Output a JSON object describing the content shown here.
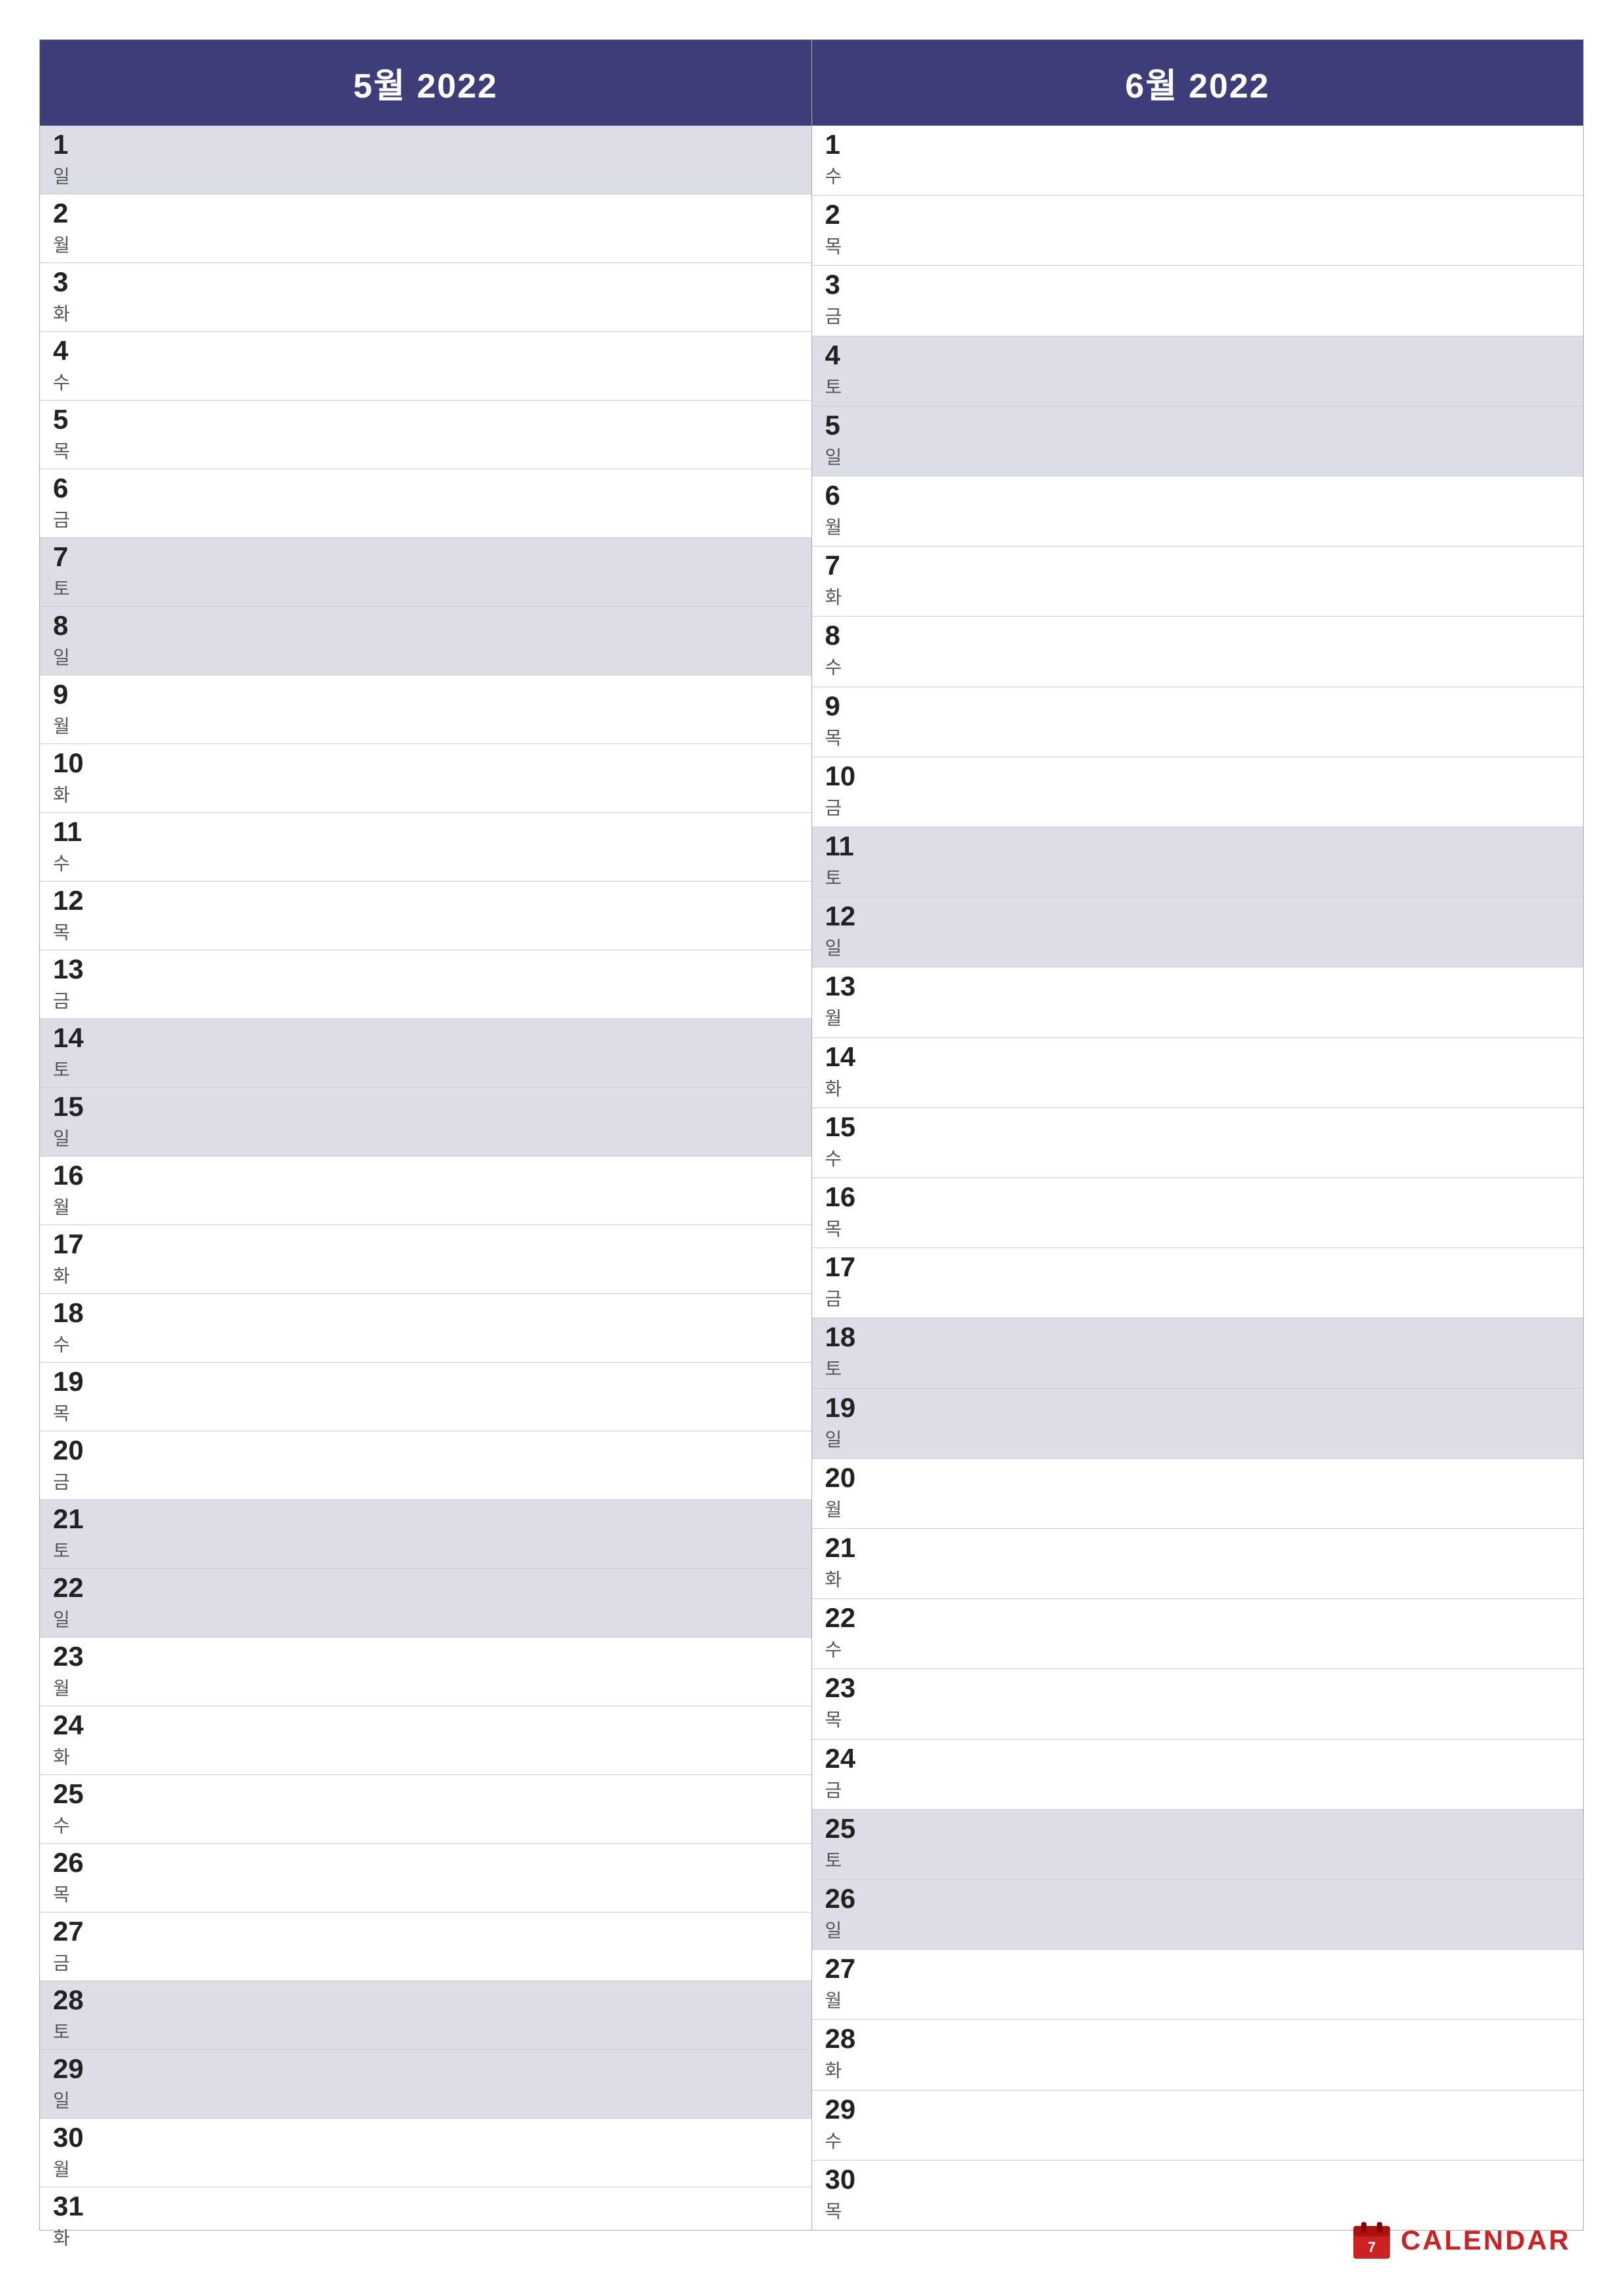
{
  "months": [
    {
      "title": "5월 2022",
      "days": [
        {
          "num": "1",
          "name": "일",
          "weekend": true
        },
        {
          "num": "2",
          "name": "월",
          "weekend": false
        },
        {
          "num": "3",
          "name": "화",
          "weekend": false
        },
        {
          "num": "4",
          "name": "수",
          "weekend": false
        },
        {
          "num": "5",
          "name": "목",
          "weekend": false
        },
        {
          "num": "6",
          "name": "금",
          "weekend": false
        },
        {
          "num": "7",
          "name": "토",
          "weekend": true
        },
        {
          "num": "8",
          "name": "일",
          "weekend": true
        },
        {
          "num": "9",
          "name": "월",
          "weekend": false
        },
        {
          "num": "10",
          "name": "화",
          "weekend": false
        },
        {
          "num": "11",
          "name": "수",
          "weekend": false
        },
        {
          "num": "12",
          "name": "목",
          "weekend": false
        },
        {
          "num": "13",
          "name": "금",
          "weekend": false
        },
        {
          "num": "14",
          "name": "토",
          "weekend": true
        },
        {
          "num": "15",
          "name": "일",
          "weekend": true
        },
        {
          "num": "16",
          "name": "월",
          "weekend": false
        },
        {
          "num": "17",
          "name": "화",
          "weekend": false
        },
        {
          "num": "18",
          "name": "수",
          "weekend": false
        },
        {
          "num": "19",
          "name": "목",
          "weekend": false
        },
        {
          "num": "20",
          "name": "금",
          "weekend": false
        },
        {
          "num": "21",
          "name": "토",
          "weekend": true
        },
        {
          "num": "22",
          "name": "일",
          "weekend": true
        },
        {
          "num": "23",
          "name": "월",
          "weekend": false
        },
        {
          "num": "24",
          "name": "화",
          "weekend": false
        },
        {
          "num": "25",
          "name": "수",
          "weekend": false
        },
        {
          "num": "26",
          "name": "목",
          "weekend": false
        },
        {
          "num": "27",
          "name": "금",
          "weekend": false
        },
        {
          "num": "28",
          "name": "토",
          "weekend": true
        },
        {
          "num": "29",
          "name": "일",
          "weekend": true
        },
        {
          "num": "30",
          "name": "월",
          "weekend": false
        },
        {
          "num": "31",
          "name": "화",
          "weekend": false
        }
      ]
    },
    {
      "title": "6월 2022",
      "days": [
        {
          "num": "1",
          "name": "수",
          "weekend": false
        },
        {
          "num": "2",
          "name": "목",
          "weekend": false
        },
        {
          "num": "3",
          "name": "금",
          "weekend": false
        },
        {
          "num": "4",
          "name": "토",
          "weekend": true
        },
        {
          "num": "5",
          "name": "일",
          "weekend": true
        },
        {
          "num": "6",
          "name": "월",
          "weekend": false
        },
        {
          "num": "7",
          "name": "화",
          "weekend": false
        },
        {
          "num": "8",
          "name": "수",
          "weekend": false
        },
        {
          "num": "9",
          "name": "목",
          "weekend": false
        },
        {
          "num": "10",
          "name": "금",
          "weekend": false
        },
        {
          "num": "11",
          "name": "토",
          "weekend": true
        },
        {
          "num": "12",
          "name": "일",
          "weekend": true
        },
        {
          "num": "13",
          "name": "월",
          "weekend": false
        },
        {
          "num": "14",
          "name": "화",
          "weekend": false
        },
        {
          "num": "15",
          "name": "수",
          "weekend": false
        },
        {
          "num": "16",
          "name": "목",
          "weekend": false
        },
        {
          "num": "17",
          "name": "금",
          "weekend": false
        },
        {
          "num": "18",
          "name": "토",
          "weekend": true
        },
        {
          "num": "19",
          "name": "일",
          "weekend": true
        },
        {
          "num": "20",
          "name": "월",
          "weekend": false
        },
        {
          "num": "21",
          "name": "화",
          "weekend": false
        },
        {
          "num": "22",
          "name": "수",
          "weekend": false
        },
        {
          "num": "23",
          "name": "목",
          "weekend": false
        },
        {
          "num": "24",
          "name": "금",
          "weekend": false
        },
        {
          "num": "25",
          "name": "토",
          "weekend": true
        },
        {
          "num": "26",
          "name": "일",
          "weekend": true
        },
        {
          "num": "27",
          "name": "월",
          "weekend": false
        },
        {
          "num": "28",
          "name": "화",
          "weekend": false
        },
        {
          "num": "29",
          "name": "수",
          "weekend": false
        },
        {
          "num": "30",
          "name": "목",
          "weekend": false
        }
      ]
    }
  ],
  "logo": {
    "text": "CALENDAR",
    "icon_label": "calendar-logo-icon"
  }
}
